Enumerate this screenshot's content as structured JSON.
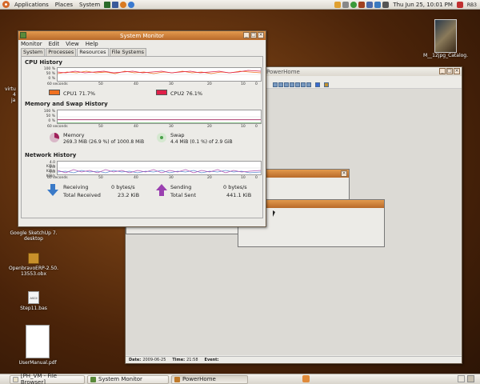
{
  "top_panel": {
    "menus": [
      "Applications",
      "Places",
      "System"
    ],
    "clock": "Thu Jun 25, 10:01 PM",
    "user": "RB3"
  },
  "desktop_icons": [
    {
      "label": "Google SketchUp 7.",
      "label2": "desktop"
    },
    {
      "label": "OpenbravoERP-2.50.",
      "label2": "13553.obx"
    },
    {
      "label": "Step11.bas",
      "icon_text": "ASCII"
    },
    {
      "label": "UserManual.pdf"
    },
    {
      "label": "M__12jpg_Catalog.",
      "label2": ""
    },
    {
      "label": "virtu",
      "label2": "4",
      "label3": "ja"
    }
  ],
  "system_monitor": {
    "title": "System Monitor",
    "menus": [
      "Monitor",
      "Edit",
      "View",
      "Help"
    ],
    "tabs": [
      "System",
      "Processes",
      "Resources",
      "File Systems"
    ],
    "active_tab": "Resources",
    "cpu": {
      "title": "CPU History",
      "y_ticks": [
        "100 %",
        "50 %",
        "0 %"
      ],
      "x_ticks": [
        "60 seconds",
        "50",
        "40",
        "30",
        "20",
        "10",
        "0"
      ],
      "cpu1_label": "CPU1",
      "cpu1_value": "71.7%",
      "cpu1_color": "#f07020",
      "cpu2_label": "CPU2",
      "cpu2_value": "76.1%",
      "cpu2_color": "#e0204a"
    },
    "memory": {
      "title": "Memory and Swap History",
      "y_ticks": [
        "100 %",
        "50 %",
        "0 %"
      ],
      "x_ticks": [
        "60 seconds",
        "50",
        "40",
        "30",
        "20",
        "10",
        "0"
      ],
      "mem_label": "Memory",
      "mem_value": "269.3 MiB (26.9 %) of 1000.8 MiB",
      "mem_color": "#a0205a",
      "swap_label": "Swap",
      "swap_value": "4.4 MiB (0.1 %) of 2.9 GiB",
      "swap_color": "#4aa04a"
    },
    "network": {
      "title": "Network History",
      "y_ticks": [
        "4.0 KiB/s",
        "2.0 KiB/s",
        "0.0 KiB/s"
      ],
      "x_ticks": [
        "60 seconds",
        "50",
        "40",
        "30",
        "20",
        "10",
        "0"
      ],
      "receiving_label": "Receiving",
      "receiving_value": "0 bytes/s",
      "total_received_label": "Total Received",
      "total_received_value": "23.2 KiB",
      "sending_label": "Sending",
      "sending_value": "0 bytes/s",
      "total_sent_label": "Total Sent",
      "total_sent_value": "441.1 KiB"
    }
  },
  "powerhome": {
    "title": "PowerHome",
    "status": {
      "date_label": "Date:",
      "date_value": "2009-06-25",
      "time_label": "Time:",
      "time_value": "21:58",
      "event_label": "Event:"
    }
  },
  "taskbar": {
    "items": [
      "[PH_VM - File Browser]",
      "System Monitor",
      "PowerHome"
    ]
  }
}
